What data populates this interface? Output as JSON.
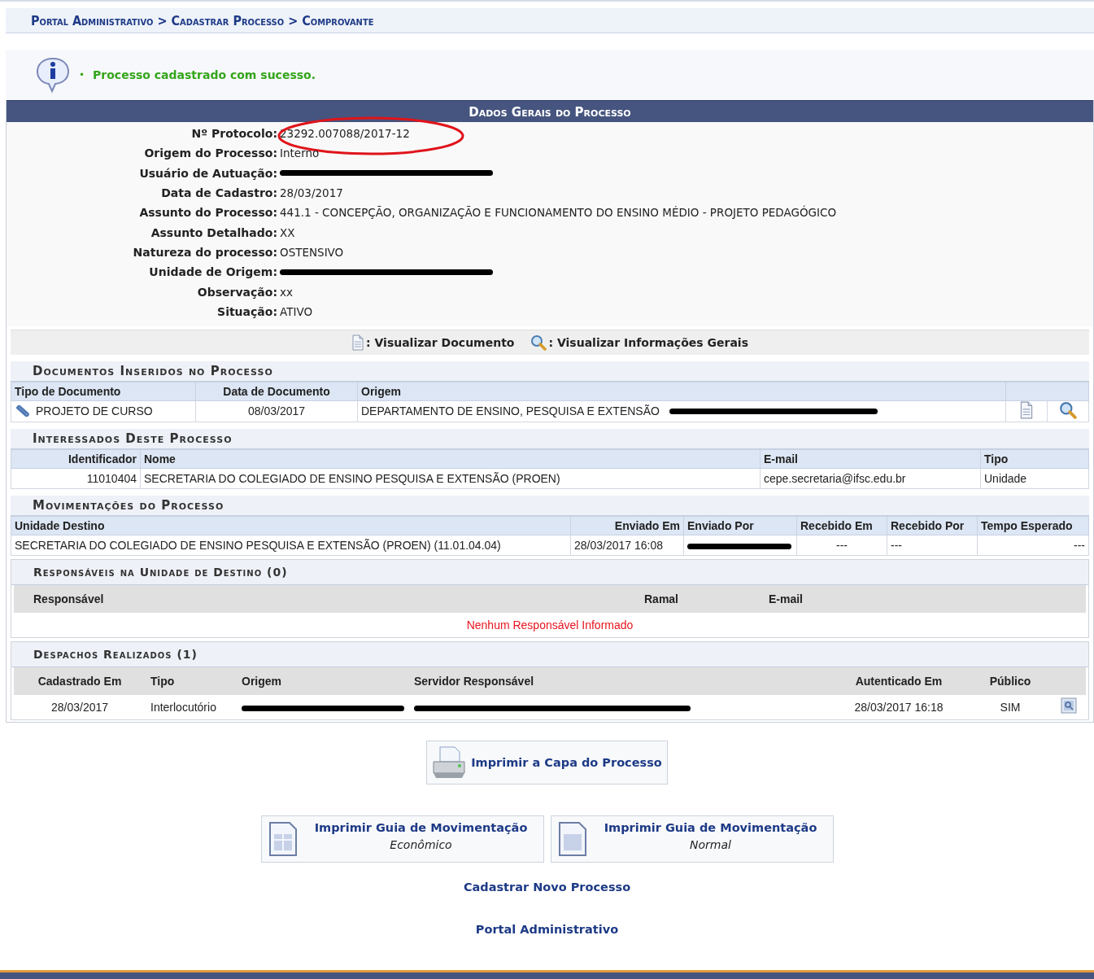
{
  "breadcrumb": "Portal Administrativo > Cadastrar Processo > Comprovante",
  "message": {
    "bullet": "•",
    "text": "Processo cadastrado com sucesso."
  },
  "general": {
    "title": "Dados Gerais do Processo",
    "fields": [
      {
        "label": "Nº Protocolo:",
        "value": "23292.007088/2017-12",
        "circled": true
      },
      {
        "label": "Origem do Processo:",
        "value": "Interno"
      },
      {
        "label": "Usuário de Autuação:",
        "redacted": true
      },
      {
        "label": "Data de Cadastro:",
        "value": "28/03/2017"
      },
      {
        "label": "Assunto do Processo:",
        "value": "441.1 - CONCEPÇÃO, ORGANIZAÇÃO E FUNCIONAMENTO DO ENSINO MÉDIO - PROJETO PEDAGÓGICO"
      },
      {
        "label": "Assunto Detalhado:",
        "value": "XX"
      },
      {
        "label": "Natureza do processo:",
        "value": "OSTENSIVO"
      },
      {
        "label": "Unidade de Origem:",
        "redacted": true
      },
      {
        "label": "Observação:",
        "value": "xx"
      },
      {
        "label": "Situação:",
        "value": "ATIVO"
      }
    ]
  },
  "legend": [
    {
      "kind": "document",
      "text": ": Visualizar Documento"
    },
    {
      "kind": "search",
      "text": ": Visualizar Informações Gerais"
    }
  ],
  "documents": {
    "title": "Documentos Inseridos no Processo",
    "columns": [
      "Tipo de Documento",
      "Data de Documento",
      "Origem"
    ],
    "rows": [
      {
        "type": "PROJETO DE CURSO",
        "date": "08/03/2017",
        "origin": "DEPARTAMENTO DE ENSINO, PESQUISA E EXTENSÃO",
        "origin_redacted": true
      }
    ]
  },
  "interested": {
    "title": "Interessados Deste Processo",
    "columns": [
      "Identificador",
      "Nome",
      "E-mail",
      "Tipo"
    ],
    "rows": [
      {
        "cells": [
          "11010404",
          "SECRETARIA DO COLEGIADO DE ENSINO PESQUISA E EXTENSÃO (PROEN)",
          "cepe.secretaria@ifsc.edu.br",
          "Unidade"
        ]
      }
    ]
  },
  "movements": {
    "title": "Movimentações do Processo",
    "columns": [
      "Unidade Destino",
      "Enviado Em",
      "Enviado Por",
      "Recebido Em",
      "Recebido Por",
      "Tempo Esperado"
    ],
    "rows": [
      {
        "unit": "SECRETARIA DO COLEGIADO DE ENSINO PESQUISA E EXTENSÃO (PROEN) (11.01.04.04)",
        "sent_at": "28/03/2017 16:08",
        "sent_by_redacted": true,
        "received_at": "---",
        "received_by": "---",
        "expected": "---"
      }
    ]
  },
  "responsibles": {
    "title": "Responsáveis na Unidade de Destino (0)",
    "columns": [
      "Responsável",
      "Ramal",
      "E-mail"
    ],
    "empty": "Nenhum Responsável Informado"
  },
  "dispatches": {
    "title": "Despachos Realizados (1)",
    "columns": [
      "Cadastrado Em",
      "Tipo",
      "Origem",
      "Servidor Responsável",
      "Autenticado Em",
      "Público"
    ],
    "rows": [
      {
        "created": "28/03/2017",
        "type": "Interlocutório",
        "origin_redacted": true,
        "server_redacted": true,
        "authenticated": "28/03/2017 16:18",
        "public": "SIM"
      }
    ]
  },
  "print_cover": "Imprimir a Capa do Processo",
  "guides": [
    {
      "title": "Imprimir Guia de Movimentação",
      "subtitle": "Econômico",
      "kind": "economic"
    },
    {
      "title": "Imprimir Guia de Movimentação",
      "subtitle": "Normal",
      "kind": "normal"
    }
  ],
  "links": [
    "Cadastrar Novo Processo",
    "Portal Administrativo"
  ]
}
